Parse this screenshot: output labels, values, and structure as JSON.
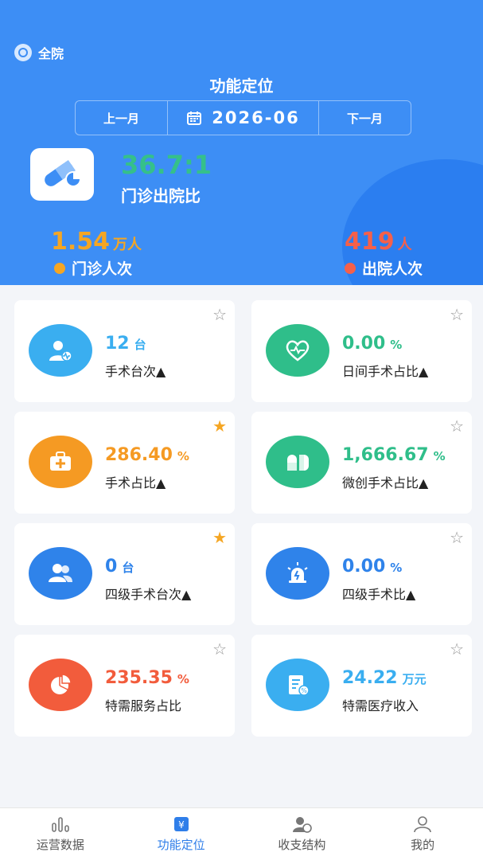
{
  "hospital": {
    "label": "全院"
  },
  "header": {
    "title": "功能定位"
  },
  "month_nav": {
    "prev_label": "上一月",
    "current": "2026-06",
    "next_label": "下一月"
  },
  "summary": {
    "ratio_value": "36.7:1",
    "ratio_label": "门诊出院比",
    "left": {
      "value": "1.54",
      "unit": "万人",
      "label": "门诊人次",
      "color": "#f5a623"
    },
    "right": {
      "value": "419",
      "unit": "人",
      "label": "出院人次",
      "color": "#f5604a"
    }
  },
  "cards": [
    {
      "value": "12",
      "unit": "台",
      "label": "手术台次▲",
      "color": "#3aaef0",
      "icon": "doctor-icon",
      "starred": false
    },
    {
      "value": "0.00",
      "unit": "%",
      "label": "日间手术占比▲",
      "color": "#2fbe8a",
      "icon": "heart-pulse-icon",
      "starred": false
    },
    {
      "value": "286.40",
      "unit": "%",
      "label": "手术占比▲",
      "color": "#f59a23",
      "icon": "medical-kit-icon",
      "starred": true
    },
    {
      "value": "1,666.67",
      "unit": "%",
      "label": "微创手术占比▲",
      "color": "#2fbe8a",
      "icon": "pill-icon",
      "starred": false
    },
    {
      "value": "0",
      "unit": "台",
      "label": "四级手术台次▲",
      "color": "#2f83ea",
      "icon": "users-icon",
      "starred": true
    },
    {
      "value": "0.00",
      "unit": "%",
      "label": "四级手术比▲",
      "color": "#2f83ea",
      "icon": "alarm-icon",
      "starred": false
    },
    {
      "value": "235.35",
      "unit": "%",
      "label": "特需服务占比",
      "color": "#f25c3c",
      "icon": "pie-chart-icon",
      "starred": false
    },
    {
      "value": "24.22",
      "unit": "万元",
      "label": "特需医疗收入",
      "color": "#3aaef0",
      "icon": "receipt-icon",
      "starred": false
    }
  ],
  "tabs": [
    {
      "label": "运营数据",
      "icon": "bar-chart-icon",
      "active": false
    },
    {
      "label": "功能定位",
      "icon": "position-icon",
      "active": true
    },
    {
      "label": "收支结构",
      "icon": "finance-user-icon",
      "active": false
    },
    {
      "label": "我的",
      "icon": "person-icon",
      "active": false
    }
  ],
  "colors": {
    "header_bg": "#3d8ef5",
    "active_tab": "#2f7ee9",
    "star_on": "#f5a623",
    "star_off": "#999999"
  }
}
